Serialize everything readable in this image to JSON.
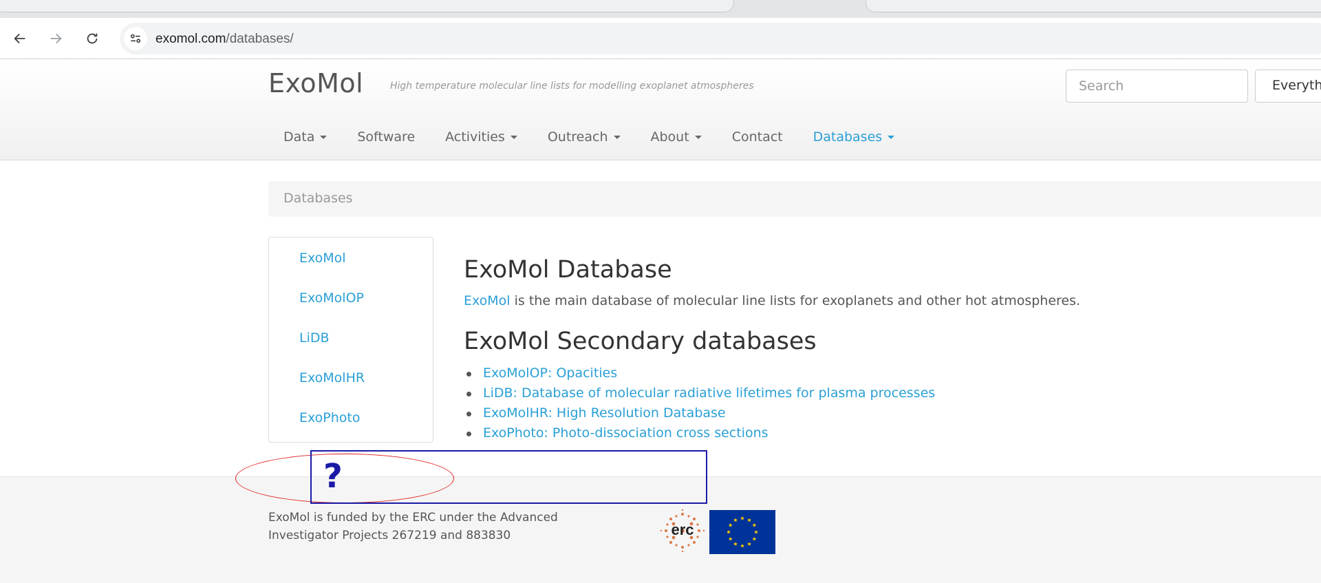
{
  "browser": {
    "url_host": "exomol.com",
    "url_path": "/databases/"
  },
  "header": {
    "brand": "ExoMol",
    "tagline": "High temperature molecular line lists for modelling exoplanet atmospheres",
    "search_placeholder": "Search",
    "scope_select": "Everyth"
  },
  "menu": {
    "items": [
      {
        "label": "Data",
        "has_caret": true
      },
      {
        "label": "Software",
        "has_caret": false
      },
      {
        "label": "Activities",
        "has_caret": true
      },
      {
        "label": "Outreach",
        "has_caret": true
      },
      {
        "label": "About",
        "has_caret": true
      },
      {
        "label": "Contact",
        "has_caret": false
      },
      {
        "label": "Databases",
        "has_caret": true,
        "active": true
      }
    ]
  },
  "breadcrumb": "Databases",
  "sidebar": {
    "links": [
      "ExoMol",
      "ExoMolOP",
      "LiDB",
      "ExoMolHR",
      "ExoPhoto"
    ]
  },
  "main": {
    "heading": "ExoMol Database",
    "intro_link": "ExoMol",
    "intro_text": " is the main database of molecular line lists for exoplanets and other hot atmospheres.",
    "secondary_heading": "ExoMol Secondary databases",
    "secondary_items": [
      "ExoMolOP: Opacities",
      "LiDB: Database of molecular radiative lifetimes for plasma processes",
      "ExoMolHR: High Resolution Database",
      "ExoPhoto: Photo-dissociation cross sections"
    ]
  },
  "footer": {
    "text": "ExoMol is funded by the ERC under the Advanced Investigator Projects 267219 and 883830",
    "erc_logo_text": "erc"
  },
  "annotation": {
    "mark": "?"
  },
  "colors": {
    "link": "#2a9fd6",
    "annotation_red": "#e02020",
    "annotation_blue": "#1a1aa6",
    "eu_blue": "#003399",
    "eu_star": "#ffcc00"
  }
}
